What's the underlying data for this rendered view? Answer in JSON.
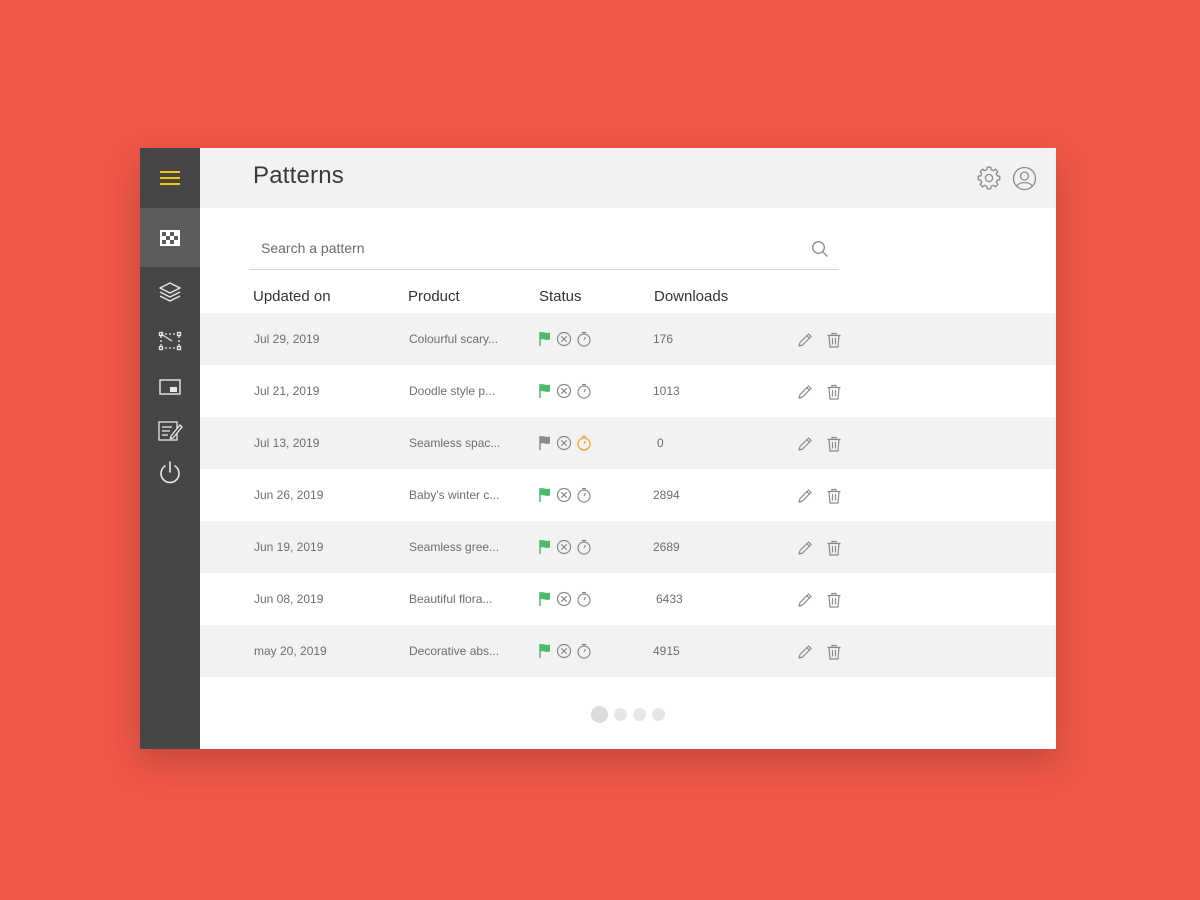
{
  "header": {
    "title": "Patterns",
    "icons": [
      "gear-icon",
      "user-icon"
    ]
  },
  "sidebar": {
    "items": [
      {
        "name": "menu",
        "icon": "hamburger-icon"
      },
      {
        "name": "patterns",
        "icon": "checkerboard-icon",
        "active": true
      },
      {
        "name": "layers",
        "icon": "layers-icon"
      },
      {
        "name": "transform",
        "icon": "transform-icon"
      },
      {
        "name": "picture-in-picture",
        "icon": "picture-in-picture-icon"
      },
      {
        "name": "edit-notes",
        "icon": "edit-notes-icon"
      },
      {
        "name": "power",
        "icon": "power-icon"
      }
    ]
  },
  "search": {
    "placeholder": "Search a pattern",
    "value": ""
  },
  "table": {
    "columns": [
      "Updated on",
      "Product",
      "Status",
      "Downloads"
    ],
    "rows": [
      {
        "date": "Jul 29, 2019",
        "product": "Colourful scary...",
        "downloads": "176",
        "flag": "green",
        "timer": "gray"
      },
      {
        "date": "Jul 21, 2019",
        "product": "Doodle style p...",
        "downloads": "1013",
        "flag": "green",
        "timer": "gray"
      },
      {
        "date": "Jul 13, 2019",
        "product": "Seamless spac...",
        "downloads": "0",
        "flag": "gray",
        "timer": "orange"
      },
      {
        "date": "Jun 26, 2019",
        "product": "Baby's winter c...",
        "downloads": "2894",
        "flag": "green",
        "timer": "gray"
      },
      {
        "date": "Jun 19, 2019",
        "product": "Seamless gree...",
        "downloads": "2689",
        "flag": "green",
        "timer": "gray"
      },
      {
        "date": "Jun 08, 2019",
        "product": "Beautiful flora...",
        "downloads": "6433",
        "flag": "green",
        "timer": "gray"
      },
      {
        "date": "may 20, 2019",
        "product": "Decorative abs...",
        "downloads": "4915",
        "flag": "green",
        "timer": "gray"
      }
    ]
  },
  "pagination": {
    "pages": 4,
    "current": 1
  },
  "colors": {
    "background": "#EF5747",
    "sidebar": "#464646",
    "accent_yellow": "#F2C500",
    "flag_green": "#4CBB6C",
    "flag_gray": "#8a8a8a",
    "timer_orange": "#F2A33A",
    "icon_gray": "#8a8a8a"
  }
}
